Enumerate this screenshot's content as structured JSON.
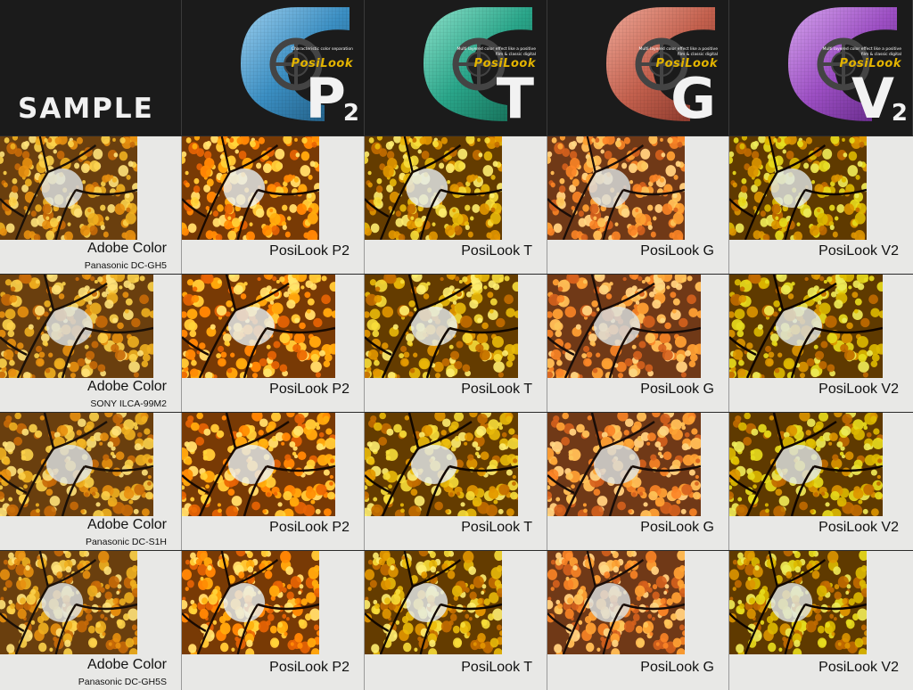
{
  "header": {
    "sample_label": "SAMPLE",
    "presets": [
      {
        "letter": "P",
        "sub": "2",
        "color": "#3b8fc3",
        "light": "#9ed0ef",
        "dark": "#1d5478",
        "tag": "Characteristic color separation",
        "brand": "PosiLook"
      },
      {
        "letter": "T",
        "sub": "",
        "color": "#2aa68a",
        "light": "#8fe3cc",
        "dark": "#136650",
        "tag": "Multi layered color effect like a positive film & classic digital",
        "brand": "PosiLook"
      },
      {
        "letter": "G",
        "sub": "",
        "color": "#c4614e",
        "light": "#f0aa9a",
        "dark": "#7e3024",
        "tag": "Multi layered color effect like a positive film & classic digital",
        "brand": "PosiLook"
      },
      {
        "letter": "V",
        "sub": "2",
        "color": "#9d4fc4",
        "light": "#d7a6ef",
        "dark": "#5d2480",
        "tag": "Multi layered color effect like a positive film & classic digital",
        "brand": "PosiLook"
      }
    ]
  },
  "rows": [
    {
      "scene": "maple",
      "camera": "Panasonic DC-GH5",
      "base": "Adobe Color",
      "labels": [
        "PosiLook P2",
        "PosiLook T",
        "PosiLook G",
        "PosiLook V2"
      ]
    },
    {
      "scene": "moss",
      "camera": "SONY ILCA-99M2",
      "base": "Adobe Color",
      "labels": [
        "PosiLook P2",
        "PosiLook T",
        "PosiLook G",
        "PosiLook V2"
      ]
    },
    {
      "scene": "blossom",
      "camera": "Panasonic DC-S1H",
      "base": "Adobe Color",
      "labels": [
        "PosiLook P2",
        "PosiLook T",
        "PosiLook G",
        "PosiLook V2"
      ]
    },
    {
      "scene": "ginkgo",
      "camera": "Panasonic DC-GH5S",
      "base": "Adobe Color",
      "labels": [
        "PosiLook P2",
        "PosiLook T",
        "PosiLook G",
        "PosiLook V2"
      ]
    }
  ],
  "filters": [
    {
      "sat": 1.0,
      "hue": 0,
      "bright": 1.0,
      "contrast": 1.0
    },
    {
      "sat": 1.15,
      "hue": -6,
      "bright": 1.02,
      "contrast": 1.05
    },
    {
      "sat": 1.05,
      "hue": 6,
      "bright": 1.0,
      "contrast": 1.08
    },
    {
      "sat": 0.95,
      "hue": -12,
      "bright": 0.98,
      "contrast": 1.02
    },
    {
      "sat": 1.2,
      "hue": 10,
      "bright": 0.97,
      "contrast": 1.1
    }
  ]
}
